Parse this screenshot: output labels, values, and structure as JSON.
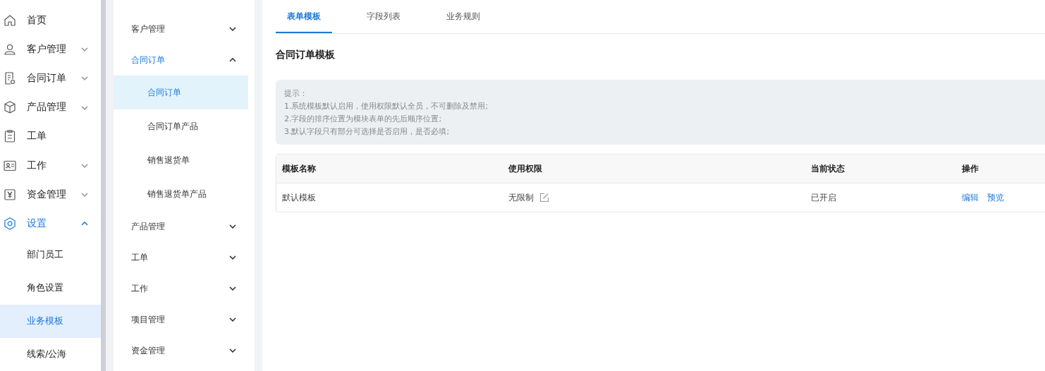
{
  "nav": {
    "items": [
      {
        "label": "首页",
        "kind": "home"
      },
      {
        "label": "客户管理",
        "kind": "user",
        "expanded": false
      },
      {
        "label": "合同订单",
        "kind": "document",
        "expanded": false
      },
      {
        "label": "产品管理",
        "kind": "box",
        "expanded": false
      },
      {
        "label": "工单",
        "kind": "clipboard"
      },
      {
        "label": "工作",
        "kind": "card",
        "expanded": false
      },
      {
        "label": "资金管理",
        "kind": "money",
        "expanded": false
      },
      {
        "label": "设置",
        "kind": "gear",
        "expanded": true,
        "children": [
          {
            "label": "部门员工",
            "selected": false
          },
          {
            "label": "角色设置",
            "selected": false
          },
          {
            "label": "业务模板",
            "selected": true
          },
          {
            "label": "线索/公海",
            "selected": false
          }
        ]
      }
    ]
  },
  "submenu": {
    "items": [
      {
        "label": "客户管理",
        "expanded": false
      },
      {
        "label": "合同订单",
        "expanded": true,
        "children": [
          {
            "label": "合同订单",
            "selected": true
          },
          {
            "label": "合同订单产品",
            "selected": false
          },
          {
            "label": "销售退货单",
            "selected": false
          },
          {
            "label": "销售退货单产品",
            "selected": false
          }
        ]
      },
      {
        "label": "产品管理",
        "expanded": false
      },
      {
        "label": "工单",
        "expanded": false
      },
      {
        "label": "工作",
        "expanded": false
      },
      {
        "label": "项目管理",
        "expanded": false
      },
      {
        "label": "资金管理",
        "expanded": false
      }
    ]
  },
  "tabs": [
    {
      "label": "表单模板",
      "selected": true
    },
    {
      "label": "字段列表",
      "selected": false
    },
    {
      "label": "业务规则",
      "selected": false
    }
  ],
  "page_title": "合同订单模板",
  "notice": {
    "title": "提示：",
    "lines": [
      "1.系统模板默认启用，使用权限默认全员，不可删除及禁用;",
      "2.字段的排序位置为模块表单的先后顺序位置;",
      "3.默认字段只有部分可选择是否启用，是否必填;"
    ]
  },
  "table": {
    "columns": [
      "模板名称",
      "使用权限",
      "当前状态",
      "操作"
    ],
    "rows": [
      {
        "name": "默认模板",
        "permission": "无限制",
        "status": "已开启",
        "actions": [
          "编辑",
          "预览"
        ]
      }
    ]
  }
}
